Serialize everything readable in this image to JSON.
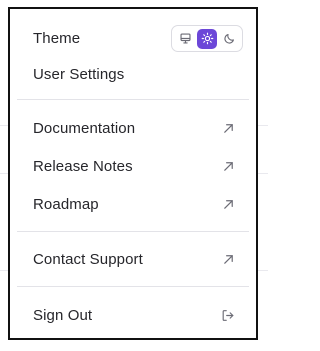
{
  "menu": {
    "theme": {
      "label": "Theme",
      "options": [
        {
          "icon": "monitor-icon",
          "label": "System"
        },
        {
          "icon": "sun-icon",
          "label": "Light",
          "active": true
        },
        {
          "icon": "moon-icon",
          "label": "Dark"
        }
      ],
      "active_color": "#6c47d8"
    },
    "user_settings": "User Settings",
    "documentation": "Documentation",
    "release_notes": "Release Notes",
    "roadmap": "Roadmap",
    "contact_support": "Contact Support",
    "sign_out": "Sign Out"
  },
  "icons": {
    "external": "external-link-icon",
    "sign_out": "sign-out-icon"
  }
}
